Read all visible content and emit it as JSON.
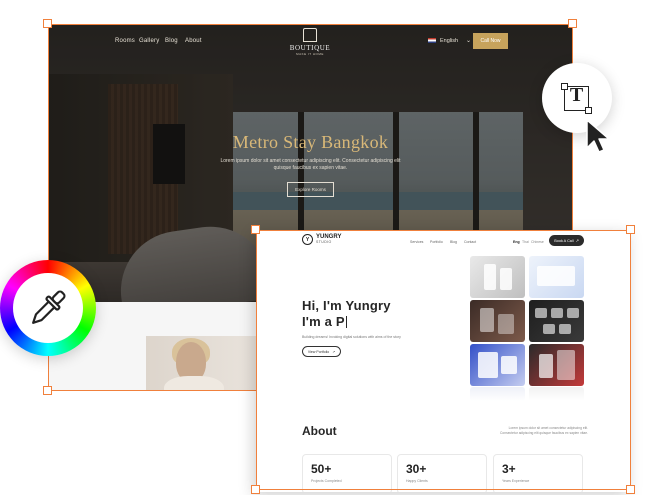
{
  "hotel": {
    "nav": [
      "Rooms",
      "Gallery",
      "Blog",
      "About"
    ],
    "brand": "BOUTIQUE",
    "brand_sub": "MAKE IT HOME",
    "language": "English",
    "cta": "Call Now",
    "hero_title": "Metro Stay Bangkok",
    "hero_desc": "Lorem ipsum dolor sit amet consectetur adipiscing elit. Consectetur adipiscing elit quisque faucibus ex sapien vitae.",
    "explore": "Explore Rooms"
  },
  "portfolio": {
    "brand": "YUNGRY",
    "brand_sub": "STUDIO",
    "logo_mark": "Y",
    "nav": [
      "Services",
      "Portfolio",
      "Blog",
      "Contact"
    ],
    "languages": [
      "Eng",
      "Thai",
      "Chinese"
    ],
    "cta": "Book A Call",
    "intro_line1": "Hi, I'm Yungry",
    "intro_line2": "I'm a P",
    "tagline": "Building dreams! Invoking digital solutions with aims of the story",
    "view_btn": "View Portfolio",
    "about_title": "About",
    "about_text": "Lorem ipsum dolor sit amet consectetur adipiscing elit. Consectetur adipiscing elit quisque faucibus ex sapien vitae.",
    "stats": [
      {
        "value": "50+",
        "label": "Projects Completed"
      },
      {
        "value": "30+",
        "label": "Happy Clients"
      },
      {
        "value": "3+",
        "label": "Years Experience"
      }
    ]
  },
  "tools": {
    "text_tool_char": "T",
    "text_tool_icon": "text-tool-icon",
    "color_tool_icon": "eyedropper-icon",
    "pointer_icon": "cursor-arrow-icon"
  },
  "colors": {
    "selection": "#f0803c",
    "gold": "#c7a35c"
  }
}
